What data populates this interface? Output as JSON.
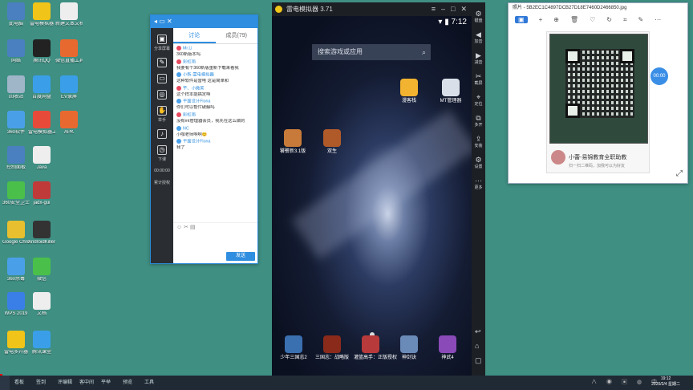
{
  "colors": {
    "desktop": "#3f8f83",
    "accent": "#2f8ee0",
    "taskbar": "#202a35"
  },
  "desktop_icons": [
    {
      "label": "此电脑",
      "icon": "computer-icon",
      "color": "#4a7fc0"
    },
    {
      "label": "雷电模拟器",
      "icon": "emulator-icon",
      "color": "#f0c419"
    },
    {
      "label": "新建文本文档",
      "icon": "document-icon",
      "color": "#eeeeee"
    },
    {
      "label": "网络",
      "icon": "network-icon",
      "color": "#4a7fc0"
    },
    {
      "label": "腾讯QQ",
      "icon": "qq-icon",
      "color": "#222222"
    },
    {
      "label": "微信直播工具",
      "icon": "live-tool-icon",
      "color": "#e8692f"
    },
    {
      "label": "回收站",
      "icon": "recycle-bin-icon",
      "color": "#9fb5c8"
    },
    {
      "label": "百度网盘",
      "icon": "cloud-icon",
      "color": "#3a9fe8"
    },
    {
      "label": "EV录屏",
      "icon": "ev-recorder-icon",
      "color": "#3a9fe8"
    },
    {
      "label": "360软件",
      "icon": "software-icon",
      "color": "#4aa0e8"
    },
    {
      "label": "雷电模拟器工具",
      "icon": "tool-icon",
      "color": "#e84a3a"
    },
    {
      "label": "APK",
      "icon": "apk-icon",
      "color": "#e8692f"
    },
    {
      "label": "控制面板",
      "icon": "control-panel-icon",
      "color": "#4a7fc0"
    },
    {
      "label": "Java",
      "icon": "java-icon",
      "color": "#eeeeee"
    },
    {
      "label": "360安全卫士",
      "icon": "360-icon",
      "color": "#4ac04a"
    },
    {
      "label": "jadx-gui",
      "icon": "jadx-icon",
      "color": "#c03a3a"
    },
    {
      "label": "Google Chrome",
      "icon": "chrome-icon",
      "color": "#e8c02f"
    },
    {
      "label": "AndroidKiller",
      "icon": "android-killer-icon",
      "color": "#333333"
    },
    {
      "label": "360杀毒",
      "icon": "antivirus-icon",
      "color": "#4aa0e8"
    },
    {
      "label": "微信",
      "icon": "wechat-icon",
      "color": "#4ac04a"
    },
    {
      "label": "WPS 2019",
      "icon": "wps-icon",
      "color": "#3a7fe8"
    },
    {
      "label": "文档",
      "icon": "file-icon",
      "color": "#eeeeee"
    },
    {
      "label": "雷电多开器",
      "icon": "multi-instance-icon",
      "color": "#f0c419"
    },
    {
      "label": "腾讯课堂",
      "icon": "classroom-icon",
      "color": "#3a9fe8"
    }
  ],
  "chat": {
    "side": [
      {
        "label": "分享屏幕",
        "g": "▣"
      },
      {
        "label": "",
        "g": "✎"
      },
      {
        "label": "",
        "g": "▭"
      },
      {
        "label": "",
        "g": "◎"
      },
      {
        "label": "举手",
        "g": "✋"
      },
      {
        "label": "",
        "g": "♪"
      },
      {
        "label": "下课",
        "g": "◷"
      },
      {
        "label": "00:00:00",
        "g": ""
      },
      {
        "label": "累计授权",
        "g": ""
      }
    ],
    "tabs": {
      "discuss": "讨论",
      "members": "成员(79)"
    },
    "messages": [
      {
        "name": "Mr.Li",
        "text": "360新版本吗",
        "b": false
      },
      {
        "name": "彩虹雨",
        "text": "我要有个360新版重新下载来看我",
        "b": false
      },
      {
        "name": "小新-雷电模拟器",
        "text": "这种软件是雷电 这是简单和",
        "b": true
      },
      {
        "name": "芊、小微笑",
        "text": "这个样本能搞定啊",
        "b": false
      },
      {
        "name": "平面设计Fiona",
        "text": "你们可以帮忙破解吗",
        "b": true
      },
      {
        "name": "彩虹雨",
        "text": "没有mt管理器会员，我先在这么做的",
        "b": false
      },
      {
        "name": "NC",
        "text": "小咖老师啊啊😊",
        "b": true
      },
      {
        "name": "平面设计Fiona",
        "text": "我了",
        "b": true
      }
    ],
    "send_label": "发送"
  },
  "emulator": {
    "title": "雷电模拟器 3.71",
    "time": "7:12",
    "search_placeholder": "搜索游戏或应用",
    "apps": [
      {
        "label": "漫客栈",
        "color": "#f2b330"
      },
      {
        "label": "MT管理器",
        "color": "#d9dfe8"
      },
      {
        "label": "饕餮新3.1版",
        "color": "#c77a3a"
      },
      {
        "label": "双生",
        "color": "#b05a2a"
      }
    ],
    "dock": [
      {
        "label": "少年三国志2",
        "color": "#3a6fb0"
      },
      {
        "label": "三国志：战略版",
        "color": "#8a2a1a"
      },
      {
        "label": "灌篮高手：正版授权",
        "color": "#b83a3a"
      },
      {
        "label": "神剑诀",
        "color": "#6a8ab8"
      },
      {
        "label": "神武4",
        "color": "#8a4ab8"
      }
    ],
    "side": [
      {
        "g": "⚙",
        "label": "键盘"
      },
      {
        "g": "◀",
        "label": "加音"
      },
      {
        "g": "▶",
        "label": "减音"
      },
      {
        "g": "✂",
        "label": "截屏"
      },
      {
        "g": "⌖",
        "label": "定位"
      },
      {
        "g": "⧉",
        "label": "多开"
      },
      {
        "g": "⇪",
        "label": "安装"
      },
      {
        "g": "⚙",
        "label": "设置"
      },
      {
        "g": "⋯",
        "label": "更多"
      }
    ]
  },
  "photo_viewer": {
    "title": "照片 - 5B2EC1C4897DCB27D18E7460D2466850.jpg",
    "person": "小蕾-易锦教育全职助教",
    "hint": "扫一扫二维码，加我可以为好友",
    "badge": "00:00"
  },
  "taskbar": {
    "items": [
      "看板",
      "签到",
      "评编辑",
      "客中间",
      "平举",
      "预览",
      "工具"
    ],
    "tray": "∧ ◉ ▣ ◍ 中",
    "time": "19:12",
    "date": "2020/2/4 星期二"
  }
}
